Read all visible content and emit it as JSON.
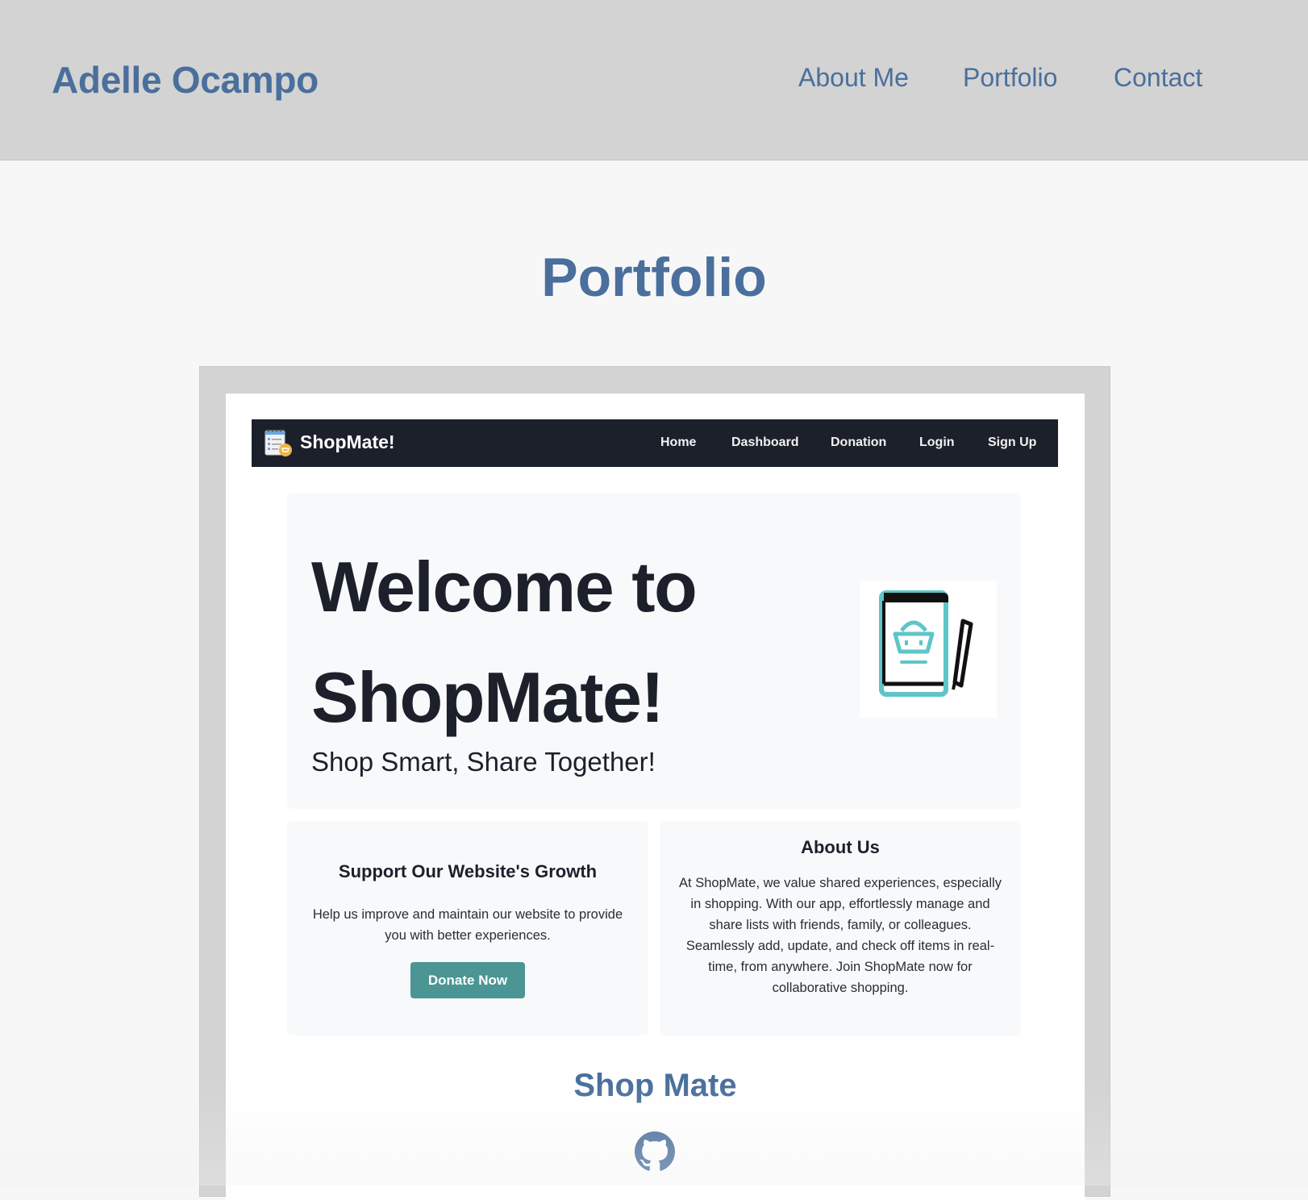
{
  "header": {
    "site_title": "Adelle Ocampo",
    "nav": [
      "About Me",
      "Portfolio",
      "Contact"
    ]
  },
  "section": {
    "title": "Portfolio"
  },
  "project": {
    "screenshot": {
      "brand": "ShopMate!",
      "nav": [
        "Home",
        "Dashboard",
        "Donation",
        "Login",
        "Sign Up"
      ],
      "hero_title": "Welcome to ShopMate!",
      "hero_subtitle": "Shop Smart, Share Together!",
      "support": {
        "heading": "Support Our Website's Growth",
        "text": "Help us improve and maintain our website to provide you with better experiences.",
        "button": "Donate Now"
      },
      "about": {
        "heading": "About Us",
        "text": "At ShopMate, we value shared experiences, especially in shopping. With our app, effortlessly manage and share lists with friends, family, or colleagues. Seamlessly add, update, and check off items in real-time, from anywhere. Join ShopMate now for collaborative shopping."
      }
    },
    "title": "Shop Mate",
    "link_icon": "github-icon"
  },
  "colors": {
    "accent": "#4a6f9c",
    "header_bg": "#d3d3d3",
    "page_bg": "#f7f7f7",
    "shopmate_nav_bg": "#1c202b",
    "donate_button": "#4b9595",
    "icon_teal": "#5ec5c8"
  }
}
